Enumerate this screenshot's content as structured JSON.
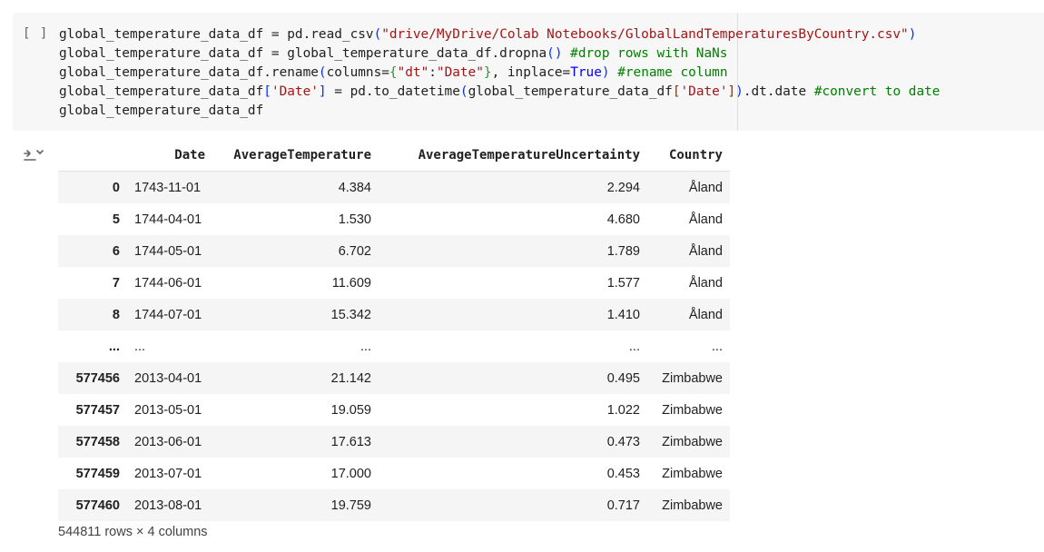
{
  "cell": {
    "run_button": "[ ]",
    "code_lines": [
      [
        {
          "t": "global_temperature_data_df = pd.read_csv"
        },
        {
          "t": "(",
          "c": "br1"
        },
        {
          "t": "\"drive/MyDrive/Colab Notebooks/GlobalLandTemperaturesByCountry.csv\"",
          "c": "str"
        },
        {
          "t": ")",
          "c": "br1"
        }
      ],
      [
        {
          "t": "global_temperature_data_df = global_temperature_data_df.dropna"
        },
        {
          "t": "()",
          "c": "br1"
        },
        {
          "t": " "
        },
        {
          "t": "#drop rows with NaNs",
          "c": "cmt"
        }
      ],
      [
        {
          "t": "global_temperature_data_df.rename"
        },
        {
          "t": "(",
          "c": "br1"
        },
        {
          "t": "columns="
        },
        {
          "t": "{",
          "c": "br2"
        },
        {
          "t": "\"dt\"",
          "c": "str"
        },
        {
          "t": ":"
        },
        {
          "t": "\"Date\"",
          "c": "str"
        },
        {
          "t": "}",
          "c": "br2"
        },
        {
          "t": ", inplace="
        },
        {
          "t": "True",
          "c": "kw"
        },
        {
          "t": ")",
          "c": "br1"
        },
        {
          "t": " "
        },
        {
          "t": "#rename column",
          "c": "cmt"
        }
      ],
      [
        {
          "t": "global_temperature_data_df"
        },
        {
          "t": "[",
          "c": "br1"
        },
        {
          "t": "'Date'",
          "c": "str"
        },
        {
          "t": "]",
          "c": "br1"
        },
        {
          "t": " = pd.to_datetime"
        },
        {
          "t": "(",
          "c": "br1"
        },
        {
          "t": "global_temperature_data_df"
        },
        {
          "t": "[",
          "c": "br3"
        },
        {
          "t": "'Date'",
          "c": "str"
        },
        {
          "t": "]",
          "c": "br3"
        },
        {
          "t": ")",
          "c": "br1"
        },
        {
          "t": ".dt.date "
        },
        {
          "t": "#convert to date",
          "c": "cmt"
        }
      ],
      [
        {
          "t": "global_temperature_data_df"
        }
      ]
    ]
  },
  "output": {
    "icon": "output-menu-icon",
    "table": {
      "columns": [
        "",
        "Date",
        "AverageTemperature",
        "AverageTemperatureUncertainty",
        "Country"
      ],
      "rows": [
        [
          "0",
          "1743-11-01",
          "4.384",
          "2.294",
          "Åland"
        ],
        [
          "5",
          "1744-04-01",
          "1.530",
          "4.680",
          "Åland"
        ],
        [
          "6",
          "1744-05-01",
          "6.702",
          "1.789",
          "Åland"
        ],
        [
          "7",
          "1744-06-01",
          "11.609",
          "1.577",
          "Åland"
        ],
        [
          "8",
          "1744-07-01",
          "15.342",
          "1.410",
          "Åland"
        ],
        [
          "...",
          "...",
          "...",
          "...",
          "..."
        ],
        [
          "577456",
          "2013-04-01",
          "21.142",
          "0.495",
          "Zimbabwe"
        ],
        [
          "577457",
          "2013-05-01",
          "19.059",
          "1.022",
          "Zimbabwe"
        ],
        [
          "577458",
          "2013-06-01",
          "17.613",
          "0.473",
          "Zimbabwe"
        ],
        [
          "577459",
          "2013-07-01",
          "17.000",
          "0.453",
          "Zimbabwe"
        ],
        [
          "577460",
          "2013-08-01",
          "19.759",
          "0.717",
          "Zimbabwe"
        ]
      ]
    },
    "shape_text": "544811 rows × 4 columns"
  }
}
